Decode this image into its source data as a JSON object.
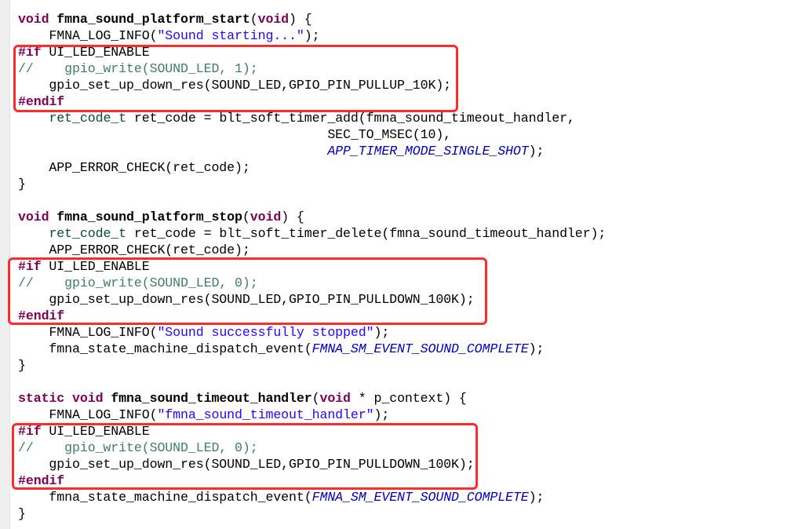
{
  "editor": {
    "colors": {
      "keyword": "#7f0055",
      "string": "#2a00ff",
      "comment": "#3f7f5f",
      "type": "#005032",
      "enum_constant": "#0000c0",
      "highlight_box": "#ff2a2a"
    },
    "lines": [
      {
        "tokens": [
          {
            "c": "kw",
            "t": "void"
          },
          {
            "c": "plain",
            "t": " "
          },
          {
            "c": "fn",
            "t": "fmna_sound_platform_start"
          },
          {
            "c": "plain",
            "t": "("
          },
          {
            "c": "kw",
            "t": "void"
          },
          {
            "c": "plain",
            "t": ") {"
          }
        ]
      },
      {
        "tokens": [
          {
            "c": "plain",
            "t": "    FMNA_LOG_INFO("
          },
          {
            "c": "str",
            "t": "\"Sound starting...\""
          },
          {
            "c": "plain",
            "t": ");"
          }
        ]
      },
      {
        "tokens": [
          {
            "c": "pp",
            "t": "#if"
          },
          {
            "c": "plain",
            "t": " UI_LED_ENABLE"
          }
        ]
      },
      {
        "tokens": [
          {
            "c": "cmt",
            "t": "//    gpio_write(SOUND_LED, 1);"
          }
        ]
      },
      {
        "tokens": [
          {
            "c": "plain",
            "t": "    gpio_set_up_down_res(SOUND_LED,GPIO_PIN_PULLUP_10K);"
          }
        ]
      },
      {
        "tokens": [
          {
            "c": "pp",
            "t": "#endif"
          }
        ]
      },
      {
        "tokens": [
          {
            "c": "plain",
            "t": "    "
          },
          {
            "c": "type",
            "t": "ret_code_t"
          },
          {
            "c": "plain",
            "t": " ret_code = blt_soft_timer_add(fmna_sound_timeout_handler,"
          }
        ]
      },
      {
        "tokens": [
          {
            "c": "plain",
            "t": "                                        SEC_TO_MSEC(10),"
          }
        ]
      },
      {
        "tokens": [
          {
            "c": "plain",
            "t": "                                        "
          },
          {
            "c": "enum",
            "t": "APP_TIMER_MODE_SINGLE_SHOT"
          },
          {
            "c": "plain",
            "t": ");"
          }
        ]
      },
      {
        "tokens": [
          {
            "c": "plain",
            "t": "    APP_ERROR_CHECK(ret_code);"
          }
        ]
      },
      {
        "tokens": [
          {
            "c": "plain",
            "t": "}"
          }
        ]
      },
      {
        "tokens": []
      },
      {
        "tokens": [
          {
            "c": "kw",
            "t": "void"
          },
          {
            "c": "plain",
            "t": " "
          },
          {
            "c": "fn",
            "t": "fmna_sound_platform_stop"
          },
          {
            "c": "plain",
            "t": "("
          },
          {
            "c": "kw",
            "t": "void"
          },
          {
            "c": "plain",
            "t": ") {"
          }
        ]
      },
      {
        "tokens": [
          {
            "c": "plain",
            "t": "    "
          },
          {
            "c": "type",
            "t": "ret_code_t"
          },
          {
            "c": "plain",
            "t": " ret_code = blt_soft_timer_delete(fmna_sound_timeout_handler);"
          }
        ]
      },
      {
        "tokens": [
          {
            "c": "plain",
            "t": "    APP_ERROR_CHECK(ret_code);"
          }
        ]
      },
      {
        "tokens": [
          {
            "c": "pp",
            "t": "#if"
          },
          {
            "c": "plain",
            "t": " UI_LED_ENABLE"
          }
        ]
      },
      {
        "tokens": [
          {
            "c": "cmt",
            "t": "//    gpio_write(SOUND_LED, 0);"
          }
        ]
      },
      {
        "tokens": [
          {
            "c": "plain",
            "t": "    gpio_set_up_down_res(SOUND_LED,GPIO_PIN_PULLDOWN_100K);"
          }
        ]
      },
      {
        "tokens": [
          {
            "c": "pp",
            "t": "#endif"
          }
        ]
      },
      {
        "tokens": [
          {
            "c": "plain",
            "t": "    FMNA_LOG_INFO("
          },
          {
            "c": "str",
            "t": "\"Sound successfully stopped\""
          },
          {
            "c": "plain",
            "t": ");"
          }
        ]
      },
      {
        "tokens": [
          {
            "c": "plain",
            "t": "    fmna_state_machine_dispatch_event("
          },
          {
            "c": "enum",
            "t": "FMNA_SM_EVENT_SOUND_COMPLETE"
          },
          {
            "c": "plain",
            "t": ");"
          }
        ]
      },
      {
        "tokens": [
          {
            "c": "plain",
            "t": "}"
          }
        ]
      },
      {
        "tokens": []
      },
      {
        "tokens": [
          {
            "c": "kw",
            "t": "static"
          },
          {
            "c": "plain",
            "t": " "
          },
          {
            "c": "kw",
            "t": "void"
          },
          {
            "c": "plain",
            "t": " "
          },
          {
            "c": "fn",
            "t": "fmna_sound_timeout_handler"
          },
          {
            "c": "plain",
            "t": "("
          },
          {
            "c": "kw",
            "t": "void"
          },
          {
            "c": "plain",
            "t": " * p_context) {"
          }
        ]
      },
      {
        "tokens": [
          {
            "c": "plain",
            "t": "    FMNA_LOG_INFO("
          },
          {
            "c": "str",
            "t": "\"fmna_sound_timeout_handler\""
          },
          {
            "c": "plain",
            "t": ");"
          }
        ]
      },
      {
        "tokens": [
          {
            "c": "pp",
            "t": "#if"
          },
          {
            "c": "plain",
            "t": " UI_LED_ENABLE"
          }
        ]
      },
      {
        "tokens": [
          {
            "c": "cmt",
            "t": "//    gpio_write(SOUND_LED, 0);"
          }
        ]
      },
      {
        "tokens": [
          {
            "c": "plain",
            "t": "    gpio_set_up_down_res(SOUND_LED,GPIO_PIN_PULLDOWN_100K);"
          }
        ]
      },
      {
        "tokens": [
          {
            "c": "pp",
            "t": "#endif"
          }
        ]
      },
      {
        "tokens": [
          {
            "c": "plain",
            "t": "    fmna_state_machine_dispatch_event("
          },
          {
            "c": "enum",
            "t": "FMNA_SM_EVENT_SOUND_COMPLETE"
          },
          {
            "c": "plain",
            "t": ");"
          }
        ]
      },
      {
        "tokens": [
          {
            "c": "plain",
            "t": "}"
          }
        ]
      }
    ],
    "highlight_boxes": [
      {
        "label": "ui-led-block-start",
        "first_line": 3,
        "last_line": 6
      },
      {
        "label": "ui-led-block-stop",
        "first_line": 16,
        "last_line": 19
      },
      {
        "label": "ui-led-block-timeout",
        "first_line": 26,
        "last_line": 29
      }
    ]
  }
}
